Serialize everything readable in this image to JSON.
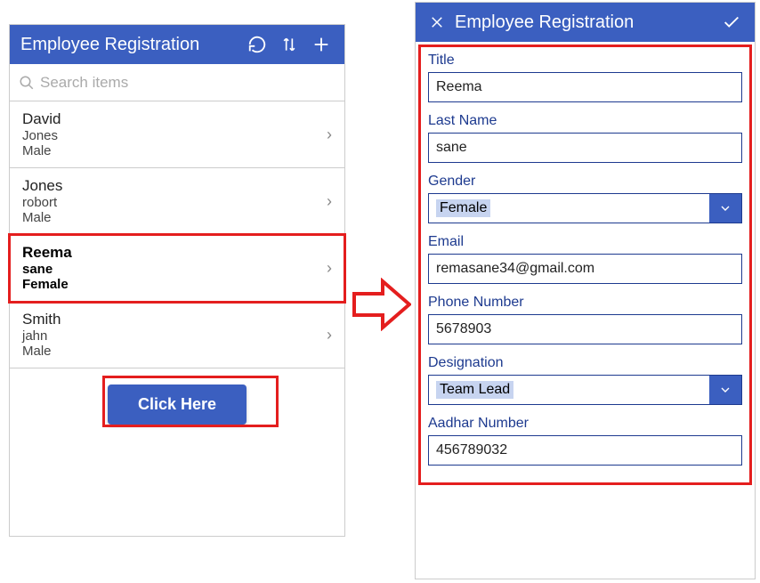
{
  "listPanel": {
    "title": "Employee Registration",
    "searchPlaceholder": "Search items",
    "items": [
      {
        "first": "David",
        "last": "Jones",
        "gender": "Male",
        "selected": false
      },
      {
        "first": "Jones",
        "last": "robort",
        "gender": "Male",
        "selected": false
      },
      {
        "first": "Reema",
        "last": "sane",
        "gender": "Female",
        "selected": true
      },
      {
        "first": "Smith",
        "last": "jahn",
        "gender": "Male",
        "selected": false
      }
    ],
    "buttonLabel": "Click Here"
  },
  "formPanel": {
    "title": "Employee Registration",
    "fields": {
      "titleLabel": "Title",
      "titleValue": "Reema",
      "lastNameLabel": "Last Name",
      "lastNameValue": "sane",
      "genderLabel": "Gender",
      "genderValue": "Female",
      "emailLabel": "Email",
      "emailValue": "remasane34@gmail.com",
      "phoneLabel": "Phone Number",
      "phoneValue": "5678903",
      "designationLabel": "Designation",
      "designationValue": "Team Lead",
      "aadharLabel": "Aadhar Number",
      "aadharValue": "456789032"
    }
  }
}
